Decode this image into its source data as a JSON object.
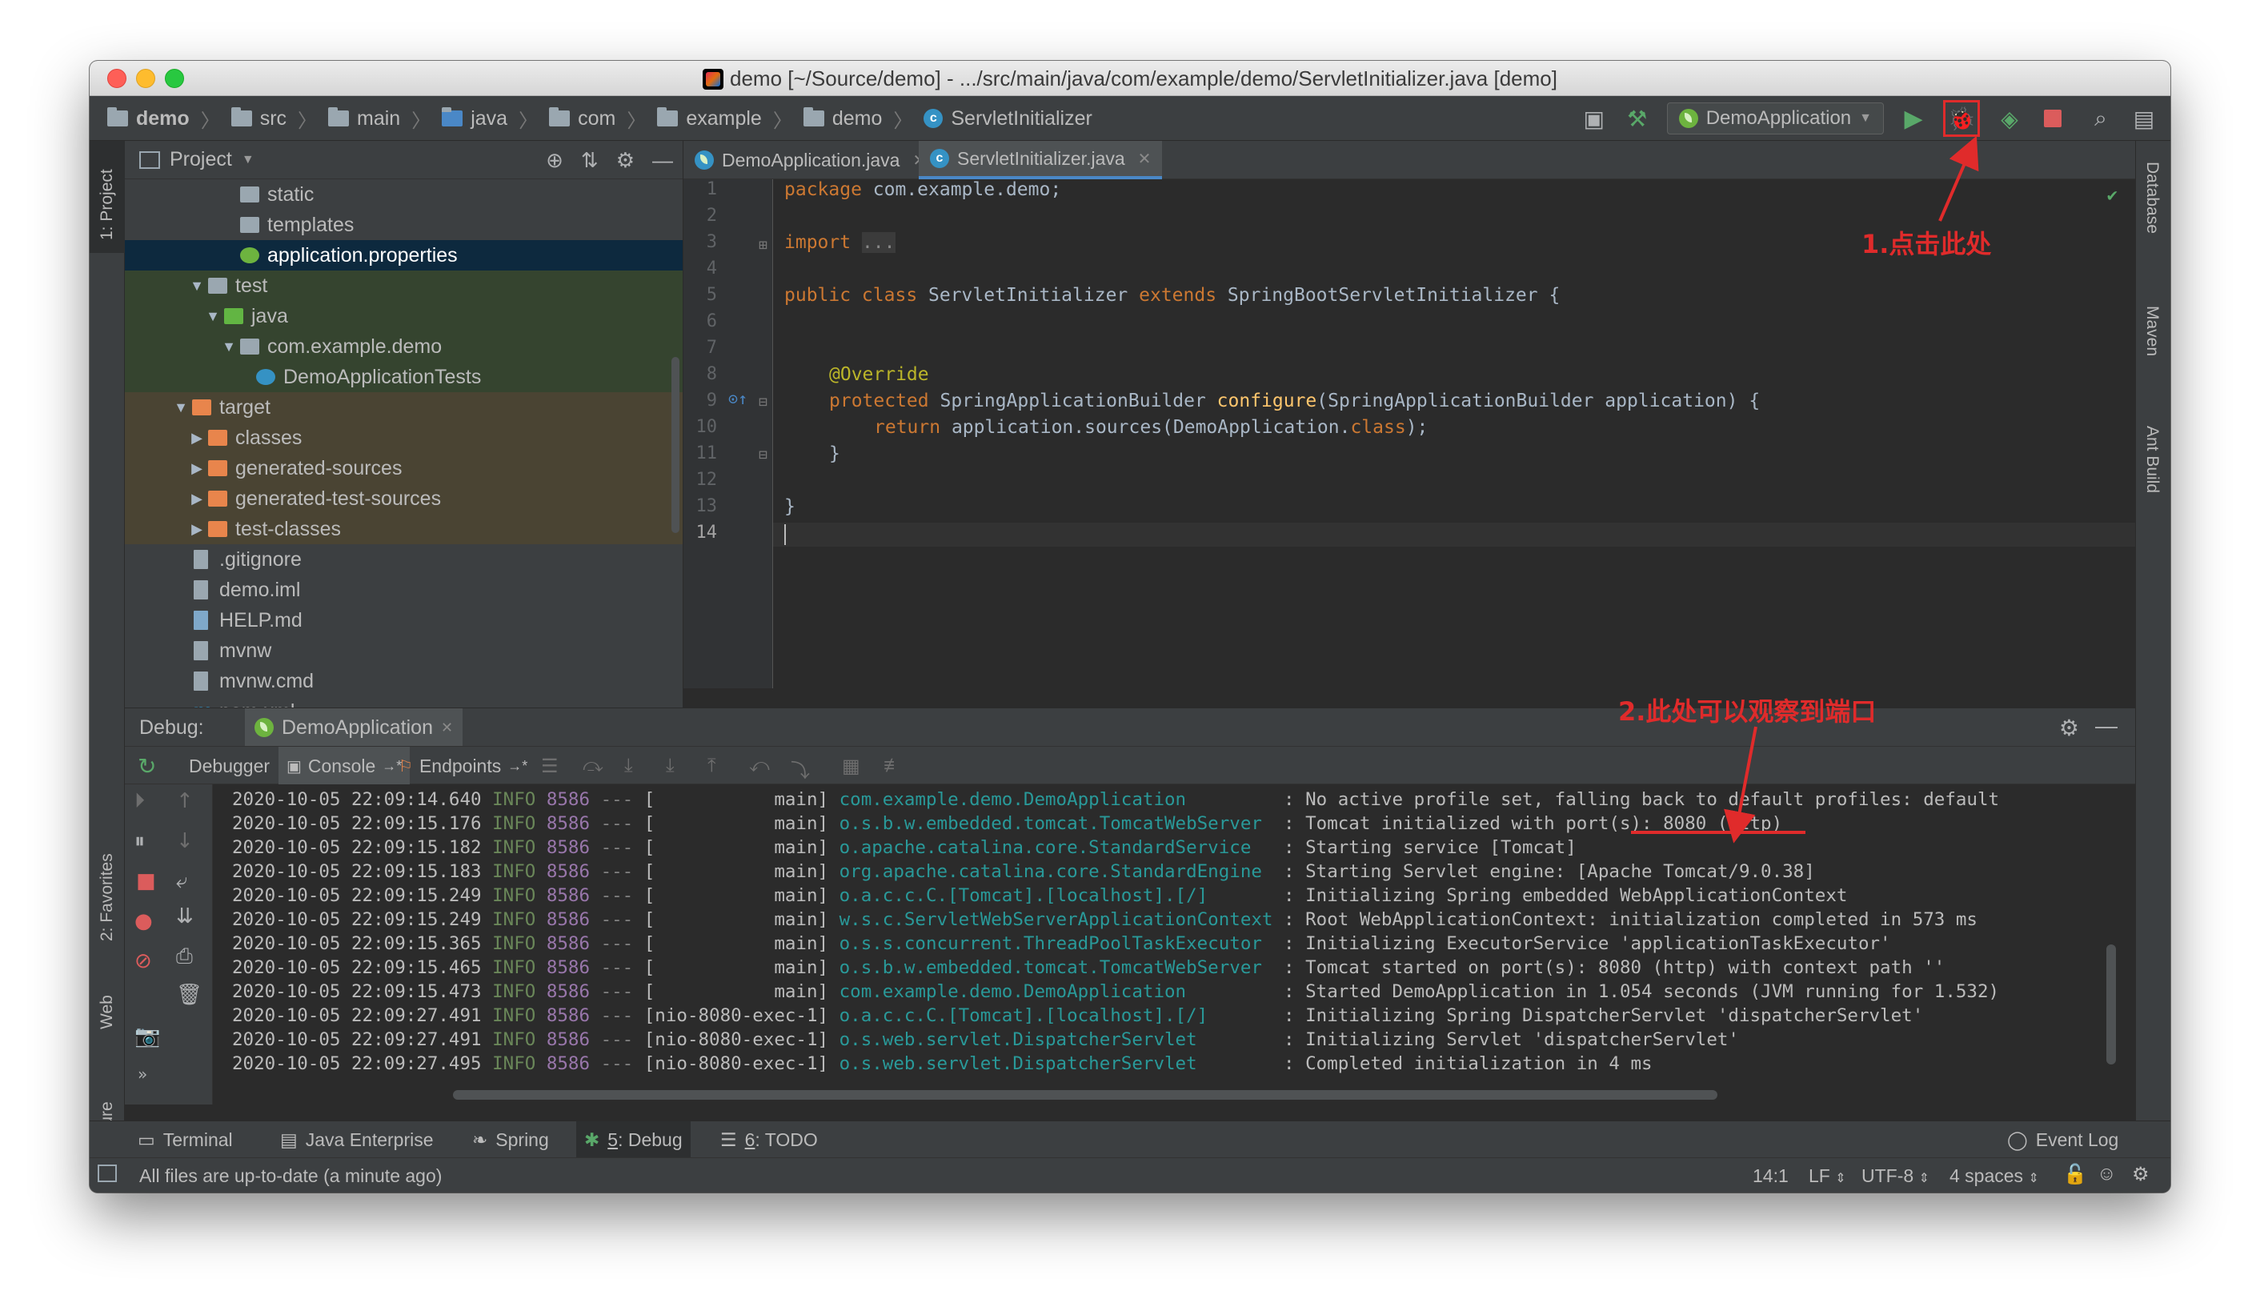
{
  "window": {
    "title": "demo [~/Source/demo] - .../src/main/java/com/example/demo/ServletInitializer.java [demo]"
  },
  "breadcrumbs": [
    "demo",
    "src",
    "main",
    "java",
    "com",
    "example",
    "demo",
    "ServletInitializer"
  ],
  "toolbar": {
    "run_config": "DemoApplication"
  },
  "left_tabs": {
    "project": "1: Project",
    "favorites": "2: Favorites",
    "web": "Web",
    "structure": "Z: Structure"
  },
  "right_tabs": {
    "database": "Database",
    "maven": "Maven",
    "ant": "Ant Build"
  },
  "project": {
    "header": "Project",
    "tree": [
      {
        "label": "static",
        "icon": "folder"
      },
      {
        "label": "templates",
        "icon": "folder"
      },
      {
        "label": "application.properties",
        "icon": "spring-leaf"
      },
      {
        "label": "test",
        "icon": "folder"
      },
      {
        "label": "java",
        "icon": "folder-green"
      },
      {
        "label": "com.example.demo",
        "icon": "package"
      },
      {
        "label": "DemoApplicationTests",
        "icon": "class"
      },
      {
        "label": "target",
        "icon": "folder-orange"
      },
      {
        "label": "classes",
        "icon": "folder-orange"
      },
      {
        "label": "generated-sources",
        "icon": "folder-orange"
      },
      {
        "label": "generated-test-sources",
        "icon": "folder-orange"
      },
      {
        "label": "test-classes",
        "icon": "folder-orange"
      },
      {
        "label": ".gitignore",
        "icon": "file"
      },
      {
        "label": "demo.iml",
        "icon": "file"
      },
      {
        "label": "HELP.md",
        "icon": "file"
      },
      {
        "label": "mvnw",
        "icon": "file"
      },
      {
        "label": "mvnw.cmd",
        "icon": "file"
      },
      {
        "label": "pom.xml",
        "icon": "maven"
      }
    ]
  },
  "editor": {
    "tabs": [
      "DemoApplication.java",
      "ServletInitializer.java"
    ],
    "active_tab": "ServletInitializer.java",
    "line_numbers": [
      "1",
      "2",
      "3",
      "4",
      "5",
      "6",
      "7",
      "8",
      "9",
      "10",
      "11",
      "12",
      "13",
      "14"
    ],
    "code": {
      "l1_kw": "package",
      "l1_rest": " com.example.demo;",
      "l3_kw": "import",
      "l3_rest": "...",
      "l5_kw": "public class",
      "l5_name": " ServletInitializer ",
      "l5_kw2": "extends",
      "l5_rest": " SpringBootServletInitializer {",
      "l8": "@Override",
      "l9_kw": "protected",
      "l9_type": " SpringApplicationBuilder ",
      "l9_fn": "configure",
      "l9_rest": "(SpringApplicationBuilder application) {",
      "l10_kw": "return",
      "l10_rest": " application.sources(DemoApplication.",
      "l10_kw2": "class",
      "l10_end": ");",
      "l11": "}",
      "l13": "}"
    }
  },
  "debug": {
    "label": "Debug:",
    "session": "DemoApplication",
    "tabs": [
      "Debugger",
      "Console",
      "Endpoints"
    ],
    "logs": [
      {
        "ts": "2020-10-05 22:09:14.640",
        "level": "INFO",
        "pid": "8586",
        "sep": "---",
        "thread": "[           main]",
        "logger": "com.example.demo.DemoApplication        ",
        "msg": ": No active profile set, falling back to default profiles: default"
      },
      {
        "ts": "2020-10-05 22:09:15.176",
        "level": "INFO",
        "pid": "8586",
        "sep": "---",
        "thread": "[           main]",
        "logger": "o.s.b.w.embedded.tomcat.TomcatWebServer ",
        "msg": ": Tomcat initialized with port(s): 8080 (http)"
      },
      {
        "ts": "2020-10-05 22:09:15.182",
        "level": "INFO",
        "pid": "8586",
        "sep": "---",
        "thread": "[           main]",
        "logger": "o.apache.catalina.core.StandardService  ",
        "msg": ": Starting service [Tomcat]"
      },
      {
        "ts": "2020-10-05 22:09:15.183",
        "level": "INFO",
        "pid": "8586",
        "sep": "---",
        "thread": "[           main]",
        "logger": "org.apache.catalina.core.StandardEngine ",
        "msg": ": Starting Servlet engine: [Apache Tomcat/9.0.38]"
      },
      {
        "ts": "2020-10-05 22:09:15.249",
        "level": "INFO",
        "pid": "8586",
        "sep": "---",
        "thread": "[           main]",
        "logger": "o.a.c.c.C.[Tomcat].[localhost].[/]      ",
        "msg": ": Initializing Spring embedded WebApplicationContext"
      },
      {
        "ts": "2020-10-05 22:09:15.249",
        "level": "INFO",
        "pid": "8586",
        "sep": "---",
        "thread": "[           main]",
        "logger": "w.s.c.ServletWebServerApplicationContext",
        "msg": ": Root WebApplicationContext: initialization completed in 573 ms"
      },
      {
        "ts": "2020-10-05 22:09:15.365",
        "level": "INFO",
        "pid": "8586",
        "sep": "---",
        "thread": "[           main]",
        "logger": "o.s.s.concurrent.ThreadPoolTaskExecutor ",
        "msg": ": Initializing ExecutorService 'applicationTaskExecutor'"
      },
      {
        "ts": "2020-10-05 22:09:15.465",
        "level": "INFO",
        "pid": "8586",
        "sep": "---",
        "thread": "[           main]",
        "logger": "o.s.b.w.embedded.tomcat.TomcatWebServer ",
        "msg": ": Tomcat started on port(s): 8080 (http) with context path ''"
      },
      {
        "ts": "2020-10-05 22:09:15.473",
        "level": "INFO",
        "pid": "8586",
        "sep": "---",
        "thread": "[           main]",
        "logger": "com.example.demo.DemoApplication        ",
        "msg": ": Started DemoApplication in 1.054 seconds (JVM running for 1.532)"
      },
      {
        "ts": "2020-10-05 22:09:27.491",
        "level": "INFO",
        "pid": "8586",
        "sep": "---",
        "thread": "[nio-8080-exec-1]",
        "logger": "o.a.c.c.C.[Tomcat].[localhost].[/]      ",
        "msg": ": Initializing Spring DispatcherServlet 'dispatcherServlet'"
      },
      {
        "ts": "2020-10-05 22:09:27.491",
        "level": "INFO",
        "pid": "8586",
        "sep": "---",
        "thread": "[nio-8080-exec-1]",
        "logger": "o.s.web.servlet.DispatcherServlet       ",
        "msg": ": Initializing Servlet 'dispatcherServlet'"
      },
      {
        "ts": "2020-10-05 22:09:27.495",
        "level": "INFO",
        "pid": "8586",
        "sep": "---",
        "thread": "[nio-8080-exec-1]",
        "logger": "o.s.web.servlet.DispatcherServlet       ",
        "msg": ": Completed initialization in 4 ms"
      }
    ]
  },
  "bottom_tools": {
    "terminal": "Terminal",
    "java_enterprise": "Java Enterprise",
    "spring": "Spring",
    "debug_num": "5",
    "debug": ": Debug",
    "todo_num": "6",
    "todo": ": TODO",
    "event_log": "Event Log"
  },
  "status": {
    "message": "All files are up-to-date (a minute ago)",
    "position": "14:1",
    "line_sep": "LF",
    "encoding": "UTF-8",
    "indent": "4 spaces"
  },
  "annotations": {
    "a1": "1.点击此处",
    "a2": "2.此处可以观察到端口"
  },
  "colors": {
    "annotation": "#e02b2b",
    "keyword": "#cc7832",
    "annotation_code": "#bbb529",
    "logger": "#299999",
    "run": "#59a869"
  }
}
